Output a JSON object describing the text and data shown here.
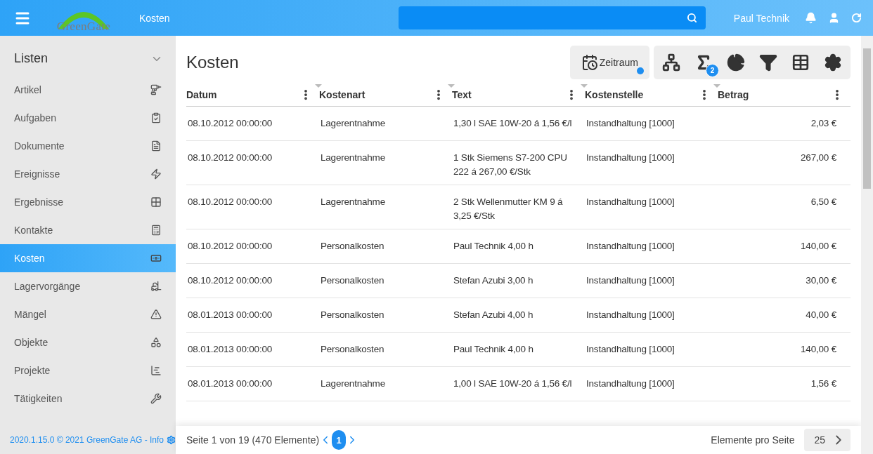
{
  "header": {
    "logo": "GreenGate",
    "page_title": "Kosten",
    "user": "Paul Technik"
  },
  "sidebar": {
    "title": "Listen",
    "expanded": true,
    "items": [
      {
        "label": "Artikel",
        "selected": false
      },
      {
        "label": "Aufgaben",
        "selected": false
      },
      {
        "label": "Dokumente",
        "selected": false
      },
      {
        "label": "Ereignisse",
        "selected": false
      },
      {
        "label": "Ergebnisse",
        "selected": false
      },
      {
        "label": "Kontakte",
        "selected": false
      },
      {
        "label": "Kosten",
        "selected": true
      },
      {
        "label": "Lagervorgänge",
        "selected": false
      },
      {
        "label": "Mängel",
        "selected": false
      },
      {
        "label": "Objekte",
        "selected": false
      },
      {
        "label": "Projekte",
        "selected": false
      },
      {
        "label": "Tätigkeiten",
        "selected": false
      }
    ],
    "footer": "2020.1.15.0 © 2021 GreenGate AG - Info"
  },
  "main": {
    "title": "Kosten",
    "period_button": {
      "label": "Zeitraum",
      "active": true
    },
    "sum_badge": "2",
    "table": {
      "columns": [
        "Datum",
        "Kostenart",
        "Text",
        "Kostenstelle",
        "Betrag"
      ],
      "rows": [
        [
          "08.10.2012 00:00:00",
          "Lagerentnahme",
          "1,30 l SAE 10W-20 á 1,56 €/l",
          "Instandhaltung [1000]",
          "2,03 €"
        ],
        [
          "08.10.2012 00:00:00",
          "Lagerentnahme",
          "1 Stk Siemens S7-200 CPU 222 á 267,00 €/Stk",
          "Instandhaltung [1000]",
          "267,00 €"
        ],
        [
          "08.10.2012 00:00:00",
          "Lagerentnahme",
          "2 Stk Wellenmutter KM 9 á 3,25 €/Stk",
          "Instandhaltung [1000]",
          "6,50 €"
        ],
        [
          "08.10.2012 00:00:00",
          "Personalkosten",
          "Paul Technik 4,00 h",
          "Instandhaltung [1000]",
          "140,00 €"
        ],
        [
          "08.10.2012 00:00:00",
          "Personalkosten",
          "Stefan Azubi 3,00 h",
          "Instandhaltung [1000]",
          "30,00 €"
        ],
        [
          "08.01.2013 00:00:00",
          "Personalkosten",
          "Stefan Azubi 4,00 h",
          "Instandhaltung [1000]",
          "40,00 €"
        ],
        [
          "08.01.2013 00:00:00",
          "Personalkosten",
          "Paul Technik 4,00 h",
          "Instandhaltung [1000]",
          "140,00 €"
        ],
        [
          "08.01.2013 00:00:00",
          "Lagerentnahme",
          "1,00 l SAE 10W-20 á 1,56 €/l",
          "Instandhaltung [1000]",
          "1,56 €"
        ]
      ]
    },
    "pagination": {
      "summary": "Seite 1 von 19 (470 Elemente)",
      "pages": [
        {
          "label": "1",
          "selected": true
        }
      ],
      "per_page_label": "Elemente pro Seite",
      "per_page": "25"
    }
  }
}
